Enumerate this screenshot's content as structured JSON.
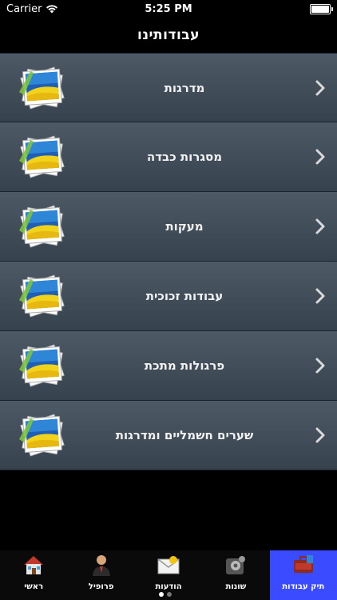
{
  "status": {
    "carrier": "Carrier",
    "time": "5:25 PM"
  },
  "nav": {
    "title": "עבודותינו"
  },
  "rows": [
    {
      "label": "מדרגות"
    },
    {
      "label": "מסגרות כבדה"
    },
    {
      "label": "מעקות"
    },
    {
      "label": "עבודות זכוכית"
    },
    {
      "label": "פרגולות מתכת"
    },
    {
      "label": "שערים חשמליים ומדרגות"
    }
  ],
  "tabs": [
    {
      "label": "ראשי",
      "icon": "house-icon"
    },
    {
      "label": "פרופיל",
      "icon": "person-icon"
    },
    {
      "label": "הודעות",
      "icon": "mail-icon"
    },
    {
      "label": "שונות",
      "icon": "gears-icon"
    },
    {
      "label": "תיק עבודות",
      "icon": "portfolio-icon",
      "active": true
    }
  ],
  "colors": {
    "tab_active": "#3b4bff",
    "row_top": "#4d5a66",
    "row_bottom": "#36424e"
  }
}
